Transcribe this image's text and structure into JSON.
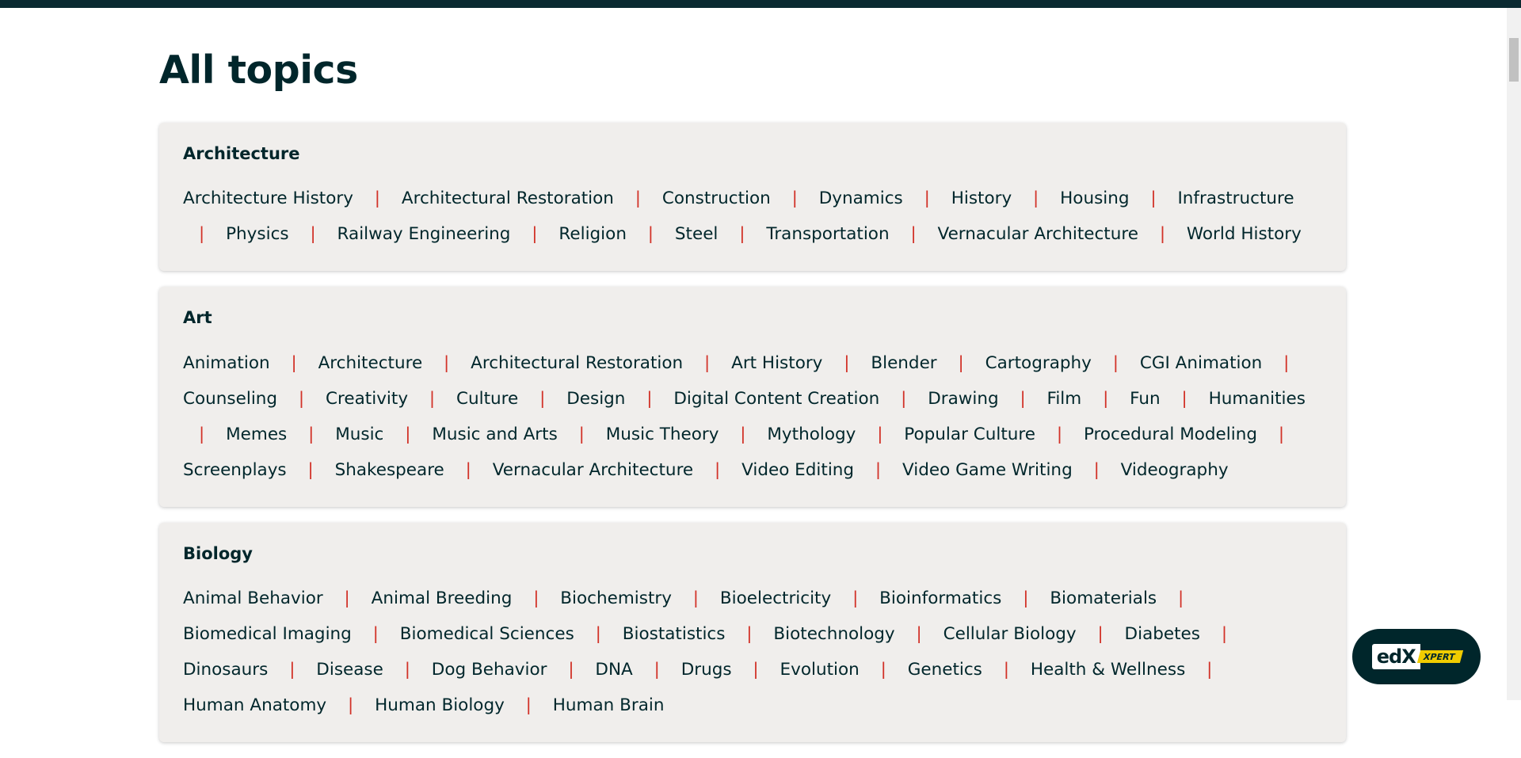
{
  "page": {
    "title": "All topics"
  },
  "categories": [
    {
      "name": "Architecture",
      "topics": [
        "Architecture History",
        "Architectural Restoration",
        "Construction",
        "Dynamics",
        "History",
        "Housing",
        "Infrastructure",
        "Physics",
        "Railway Engineering",
        "Religion",
        "Steel",
        "Transportation",
        "Vernacular Architecture",
        "World History"
      ]
    },
    {
      "name": "Art",
      "topics": [
        "Animation",
        "Architecture",
        "Architectural Restoration",
        "Art History",
        "Blender",
        "Cartography",
        "CGI Animation",
        "Counseling",
        "Creativity",
        "Culture",
        "Design",
        "Digital Content Creation",
        "Drawing",
        "Film",
        "Fun",
        "Humanities",
        "Memes",
        "Music",
        "Music and Arts",
        "Music Theory",
        "Mythology",
        "Popular Culture",
        "Procedural Modeling",
        "Screenplays",
        "Shakespeare",
        "Vernacular Architecture",
        "Video Editing",
        "Video Game Writing",
        "Videography"
      ]
    },
    {
      "name": "Biology",
      "topics": [
        "Animal Behavior",
        "Animal Breeding",
        "Biochemistry",
        "Bioelectricity",
        "Bioinformatics",
        "Biomaterials",
        "Biomedical Imaging",
        "Biomedical Sciences",
        "Biostatistics",
        "Biotechnology",
        "Cellular Biology",
        "Diabetes",
        "Dinosaurs",
        "Disease",
        "Dog Behavior",
        "DNA",
        "Drugs",
        "Evolution",
        "Genetics",
        "Health & Wellness",
        "Human Anatomy",
        "Human Biology",
        "Human Brain"
      ]
    }
  ],
  "xpert": {
    "logo_text": "edX",
    "tag_text": "XPERT"
  },
  "colors": {
    "separator": "#d23228",
    "card_bg": "#f0eeec",
    "text": "#00262b",
    "top_bar": "#0a2a31",
    "xpert_tag": "#f0cc00"
  }
}
